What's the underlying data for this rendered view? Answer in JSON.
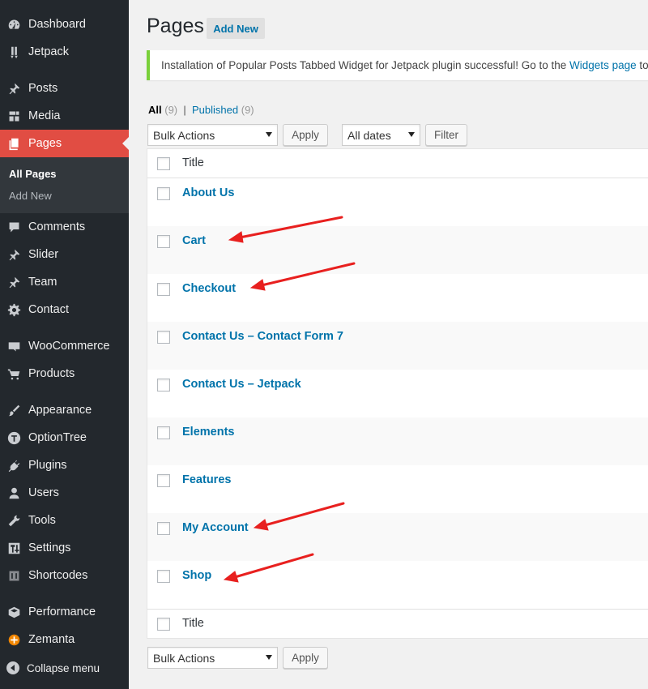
{
  "sidebar": {
    "items": [
      {
        "label": "Dashboard",
        "icon": "dashboard-icon"
      },
      {
        "label": "Jetpack",
        "icon": "jetpack-icon"
      },
      {
        "label": "Posts",
        "icon": "pin-icon"
      },
      {
        "label": "Media",
        "icon": "media-icon"
      },
      {
        "label": "Pages",
        "icon": "pages-icon",
        "active": true
      },
      {
        "label": "Comments",
        "icon": "comments-icon"
      },
      {
        "label": "Slider",
        "icon": "pin-icon"
      },
      {
        "label": "Team",
        "icon": "pin-icon"
      },
      {
        "label": "Contact",
        "icon": "gear-icon"
      },
      {
        "label": "WooCommerce",
        "icon": "woocommerce-icon"
      },
      {
        "label": "Products",
        "icon": "cart-icon"
      },
      {
        "label": "Appearance",
        "icon": "brush-icon"
      },
      {
        "label": "OptionTree",
        "icon": "optiontree-icon"
      },
      {
        "label": "Plugins",
        "icon": "plugin-icon"
      },
      {
        "label": "Users",
        "icon": "user-icon"
      },
      {
        "label": "Tools",
        "icon": "wrench-icon"
      },
      {
        "label": "Settings",
        "icon": "settings-icon"
      },
      {
        "label": "Shortcodes",
        "icon": "shortcodes-icon"
      },
      {
        "label": "Performance",
        "icon": "performance-icon"
      },
      {
        "label": "Zemanta",
        "icon": "zemanta-icon"
      }
    ],
    "submenu": [
      "All Pages",
      "Add New"
    ],
    "collapse_label": "Collapse menu"
  },
  "header": {
    "title": "Pages",
    "add_new": "Add New"
  },
  "notice": {
    "text_before": "Installation of Popular Posts Tabbed Widget for Jetpack plugin successful! Go to the ",
    "link": "Widgets page",
    "text_after": " to u"
  },
  "filters": {
    "all_label": "All",
    "all_count": "(9)",
    "separator": "|",
    "published_label": "Published",
    "published_count": "(9)"
  },
  "toolbar": {
    "bulk_actions": "Bulk Actions",
    "apply": "Apply",
    "dates": "All dates",
    "filter": "Filter"
  },
  "table": {
    "column_title": "Title",
    "rows": [
      "About Us",
      "Cart",
      "Checkout",
      "Contact Us – Contact Form 7",
      "Contact Us – Jetpack",
      "Elements",
      "Features",
      "My Account",
      "Shop"
    ]
  },
  "colors": {
    "sidebar_bg": "#23282d",
    "active_menu": "#e14d43",
    "link": "#0073aa",
    "notice_border": "#7ad03a",
    "arrow": "#e8201f"
  }
}
